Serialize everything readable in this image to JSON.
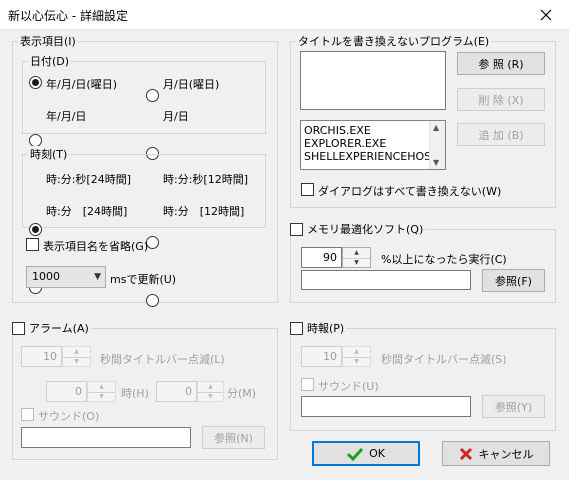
{
  "window": {
    "title": "新以心伝心 - 詳細設定"
  },
  "display": {
    "label": "表示項目(I)",
    "date": {
      "label": "日付(D)",
      "options": [
        "年/月/日(曜日)",
        "月/日(曜日)",
        "年/月/日",
        "月/日"
      ],
      "selected": 0
    },
    "time": {
      "label": "時刻(T)",
      "options": [
        "時:分:秒[24時間]",
        "時:分:秒[12時間]",
        "時:分　[24時間]",
        "時:分　[12時間]"
      ],
      "selected": 0
    },
    "omit_label": "表示項目名を省略(G)",
    "interval_value": "1000",
    "interval_suffix": "msで更新(U)"
  },
  "title_exclusion": {
    "label": "タイトルを書き換えないプログラム(E)",
    "browse_button": "参 照 (R)",
    "delete_button": "削 除 (X)",
    "add_button": "追 加 (B)",
    "programs": [
      "ORCHIS.EXE",
      "EXPLORER.EXE",
      "SHELLEXPERIENCEHOST"
    ],
    "dialog_label": "ダイアログはすべて書き換えない(W)"
  },
  "memory": {
    "label": "メモリ最適化ソフト(Q)",
    "percent_value": "90",
    "percent_suffix": "%以上になったら実行(C)",
    "path_value": "",
    "browse_button": "参照(F)"
  },
  "alarm": {
    "label": "アラーム(A)",
    "blink_value": "10",
    "blink_suffix": "秒間タイトルバー点滅(L)",
    "hour_value": "0",
    "hour_suffix": "時(H)",
    "minute_value": "0",
    "minute_suffix": "分(M)",
    "sound_label": "サウンド(O)",
    "browse_button": "参照(N)"
  },
  "timesignal": {
    "label": "時報(P)",
    "blink_value": "10",
    "blink_suffix": "秒間タイトルバー点滅(S)",
    "sound_label": "サウンド(U)",
    "browse_button": "参照(Y)"
  },
  "footer": {
    "ok_button": "OK",
    "cancel_button": "キャンセル"
  },
  "colors": {
    "ok_check": "#1e9e1e",
    "cancel_x": "#c8281e",
    "focus_border": "#0078d7"
  }
}
